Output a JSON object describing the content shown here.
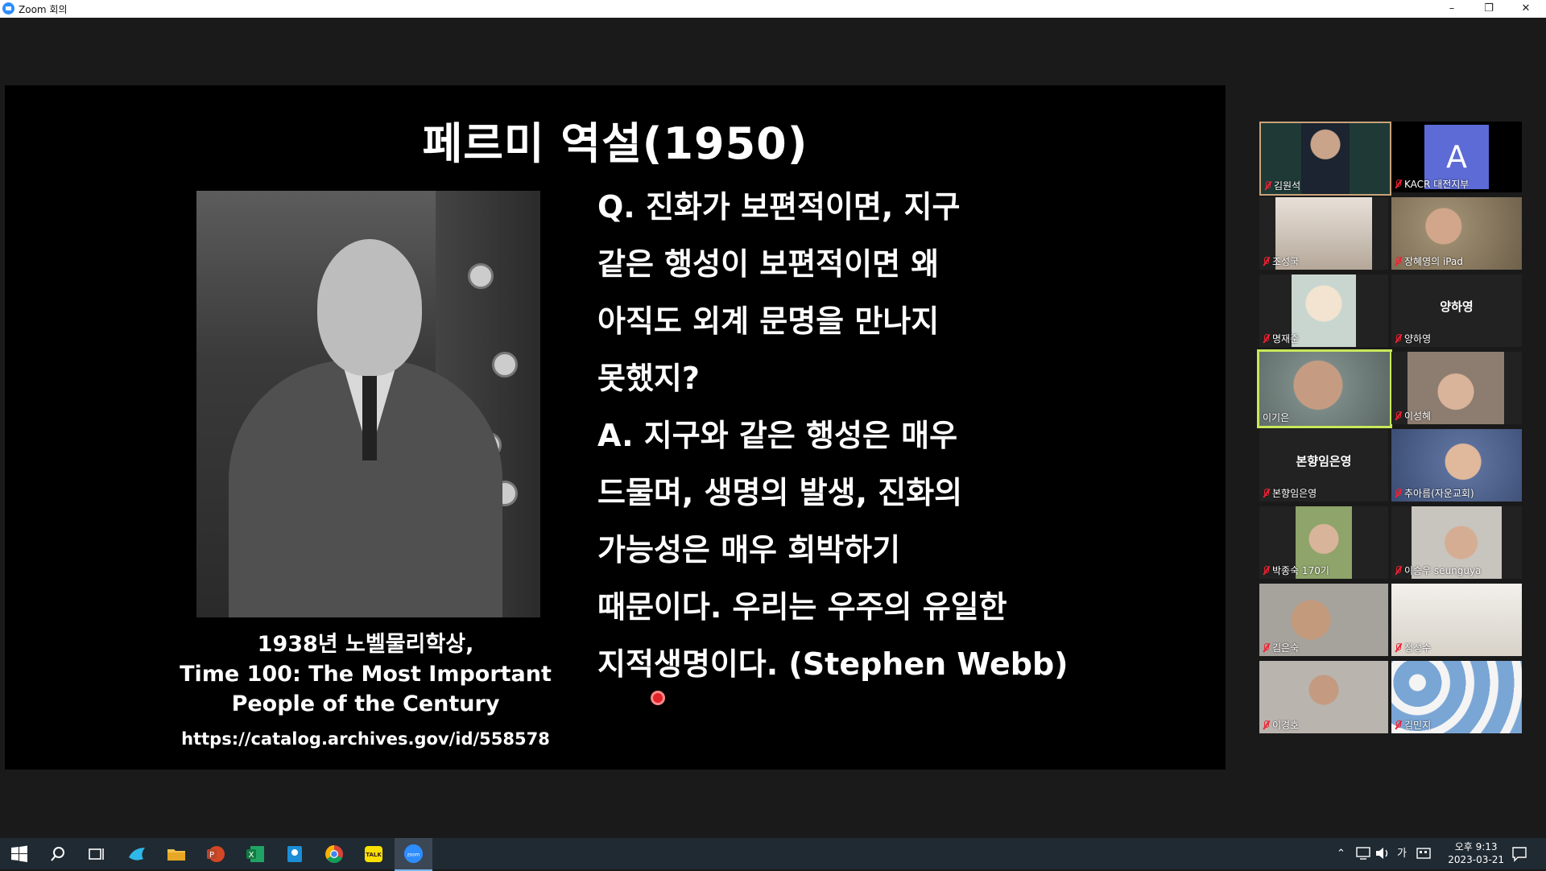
{
  "window": {
    "title": "Zoom 회의",
    "minimize": "–",
    "restore": "❐",
    "close": "✕"
  },
  "slide": {
    "title": "페르미 역설(1950)",
    "caption_lines": [
      "1938년 노벨물리학상,",
      "Time 100: The Most Important",
      "People of the Century"
    ],
    "url": "https://catalog.archives.gov/id/558578",
    "qa_lines": [
      "Q. 진화가 보편적이면, 지구",
      "같은 행성이 보편적이면 왜",
      "아직도 외계 문명을 만나지",
      "못했지?",
      "A. 지구와 같은 행성은 매우",
      "드물며, 생명의 발생, 진화의",
      "가능성은 매우 희박하기",
      "때문이다. 우리는 우주의 유일한",
      "지적생명이다. (Stephen Webb)"
    ]
  },
  "participants": [
    {
      "name": "김원석",
      "video": "teacher-board",
      "muted": true
    },
    {
      "name": "KACR 대전지부",
      "video": "avatar",
      "avatar_letter": "A",
      "muted": true
    },
    {
      "name": "조성국",
      "video": "room",
      "muted": true
    },
    {
      "name": "장혜영의 iPad",
      "video": "person",
      "muted": true
    },
    {
      "name": "명재준",
      "video": "cartoon",
      "muted": true
    },
    {
      "name": "양하영",
      "video": "none",
      "center_name": "양하영",
      "muted": true
    },
    {
      "name": "이기은",
      "video": "person-active",
      "muted": false
    },
    {
      "name": "이성혜",
      "video": "person",
      "muted": true
    },
    {
      "name": "본향임은영",
      "video": "none",
      "center_name": "본향임은영",
      "muted": true
    },
    {
      "name": "추아름(자운교회)",
      "video": "person",
      "muted": true
    },
    {
      "name": "박종숙 170기",
      "video": "person",
      "muted": true
    },
    {
      "name": "이승우 seunguya",
      "video": "person",
      "muted": true
    },
    {
      "name": "김은숙",
      "video": "person",
      "muted": true
    },
    {
      "name": "정성수",
      "video": "room",
      "muted": true
    },
    {
      "name": "이경호",
      "video": "person",
      "muted": true
    },
    {
      "name": "김민지",
      "video": "wallpaper",
      "muted": true
    }
  ],
  "taskbar": {
    "ime": "가",
    "time": "오후 9:13",
    "date": "2023-03-21"
  },
  "colors": {
    "active_speaker_border": "#c8e85a",
    "zoom_blue": "#2d8cff",
    "taskbar_bg": "#202a32"
  }
}
